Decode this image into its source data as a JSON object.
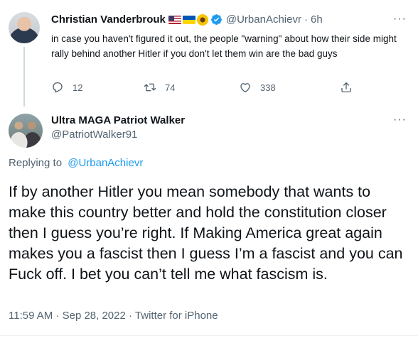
{
  "original_tweet": {
    "author_name": "Christian Vanderbrouk",
    "author_handle": "@UrbanAchievr",
    "time_ago": "6h",
    "separator": "·",
    "text": "in case you haven't figured it out, the people \"warning\" about how their side might rally behind another Hitler if you don't let them win are the bad guys",
    "reply_count": "12",
    "retweet_count": "74",
    "like_count": "338",
    "more_label": "···"
  },
  "reply_tweet": {
    "author_name": "Ultra MAGA Patriot Walker",
    "author_handle": "@PatriotWalker91",
    "more_label": "···",
    "replying_prefix": "Replying to",
    "replying_to": "@UrbanAchievr",
    "text": "If by another Hitler you mean somebody that wants to make this country better and hold the constitution closer then I guess you’re right. If Making America great again makes you a fascist then I guess I’m a fascist and you can Fuck off. I bet you can’t tell me what fascism is.",
    "timestamp": "11:59 AM · Sep 28, 2022 · Twitter for iPhone"
  },
  "colors": {
    "accent": "#1d9bf0",
    "secondary_text": "#536471",
    "primary_text": "#0f1419"
  },
  "icons": {
    "reply": "reply-icon",
    "retweet": "retweet-icon",
    "like": "heart-icon",
    "share": "share-icon",
    "verified": "verified-badge-icon"
  }
}
